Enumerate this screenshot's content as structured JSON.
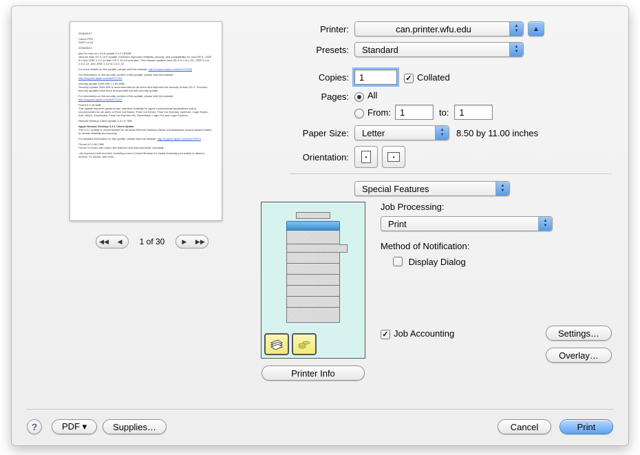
{
  "header": {
    "printer_label": "Printer:",
    "printer_value": "can.printer.wfu.edu",
    "presets_label": "Presets:",
    "presets_value": "Standard"
  },
  "copies": {
    "label": "Copies:",
    "value": "1",
    "collated_label": "Collated",
    "collated_checked": true
  },
  "pages": {
    "label": "Pages:",
    "all_label": "All",
    "all_selected": true,
    "from_label": "From:",
    "from_value": "1",
    "to_label": "to:",
    "to_value": "1"
  },
  "paper_size": {
    "label": "Paper Size:",
    "value": "Letter",
    "dimensions": "8.50 by 11.00 inches"
  },
  "orientation": {
    "label": "Orientation:"
  },
  "panel_selector": "Special Features",
  "special": {
    "job_processing_label": "Job Processing:",
    "job_processing_value": "Print",
    "method_label": "Method of Notification:",
    "display_dialog_label": "Display Dialog",
    "display_dialog_checked": false,
    "job_accounting_label": "Job Accounting",
    "job_accounting_checked": true,
    "settings_button": "Settings…",
    "overlay_button": "Overlay…",
    "printer_info_button": "Printer Info"
  },
  "preview": {
    "page_indicator": "1 of 30"
  },
  "footer": {
    "help": "?",
    "pdf_button": "PDF ▾",
    "supplies_button": "Supplies…",
    "cancel_button": "Cancel",
    "print_button": "Print"
  }
}
